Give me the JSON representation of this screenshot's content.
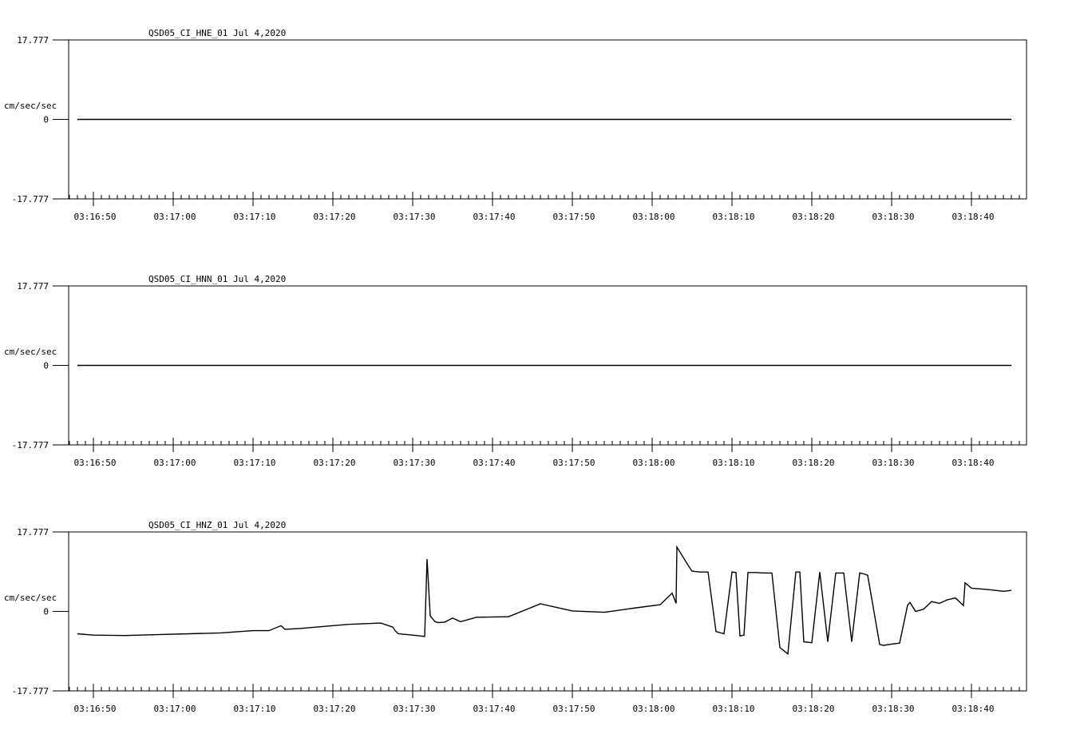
{
  "chart_data": [
    {
      "type": "line",
      "title": "QSD05_CI_HNE_01  Jul 4,2020",
      "ylabel": "cm/sec/sec",
      "ylim": [
        -17.777,
        17.777
      ],
      "y_tick_labels": [
        "17.777",
        "0",
        "-17.777"
      ],
      "x_tick_labels": [
        "03:16:50",
        "03:17:00",
        "03:17:10",
        "03:17:20",
        "03:17:30",
        "03:17:40",
        "03:17:50",
        "03:18:00",
        "03:18:10",
        "03:18:20",
        "03:18:30",
        "03:18:40"
      ],
      "xlim_seconds": [
        -3,
        117
      ],
      "grid": false,
      "series": [
        {
          "x": [
            0,
            117
          ],
          "y": [
            0,
            0
          ]
        }
      ]
    },
    {
      "type": "line",
      "title": "QSD05_CI_HNN_01  Jul 4,2020",
      "ylabel": "cm/sec/sec",
      "ylim": [
        -17.777,
        17.777
      ],
      "y_tick_labels": [
        "17.777",
        "0",
        "-17.777"
      ],
      "x_tick_labels": [
        "03:16:50",
        "03:17:00",
        "03:17:10",
        "03:17:20",
        "03:17:30",
        "03:17:40",
        "03:17:50",
        "03:18:00",
        "03:18:10",
        "03:18:20",
        "03:18:30",
        "03:18:40"
      ],
      "xlim_seconds": [
        -3,
        117
      ],
      "grid": false,
      "series": [
        {
          "x": [
            0,
            117
          ],
          "y": [
            0,
            0
          ]
        }
      ]
    },
    {
      "type": "line",
      "title": "QSD05_CI_HNZ_01  Jul 4,2020",
      "ylabel": "cm/sec/sec",
      "ylim": [
        -17.777,
        17.777
      ],
      "y_tick_labels": [
        "17.777",
        "0",
        "-17.777"
      ],
      "x_tick_labels": [
        "03:16:50",
        "03:17:00",
        "03:17:10",
        "03:17:20",
        "03:17:30",
        "03:17:40",
        "03:17:50",
        "03:18:00",
        "03:18:10",
        "03:18:20",
        "03:18:30",
        "03:18:40"
      ],
      "xlim_seconds": [
        -3,
        117
      ],
      "grid": false,
      "series": [
        {
          "x": [
            0,
            2,
            6,
            10,
            14,
            18,
            22,
            24,
            25.5,
            26,
            28,
            30,
            34,
            38,
            39.5,
            39.8,
            40.2,
            42,
            43.5,
            43.8,
            44.2,
            44.8,
            45.2,
            46,
            47,
            48,
            50,
            54,
            58,
            62,
            66,
            70,
            73,
            74.5,
            75,
            75.1,
            76.5,
            77,
            78,
            79,
            80,
            81,
            82,
            82.5,
            83,
            83.5,
            84,
            85,
            86,
            87,
            88,
            89,
            90,
            90.5,
            91,
            92,
            93,
            94,
            95,
            96,
            97,
            98,
            98.5,
            99,
            100.5,
            101,
            102,
            103,
            104,
            104.3,
            105,
            106,
            107,
            108,
            109,
            110,
            111,
            111.2,
            112,
            114,
            116,
            117
          ],
          "y": [
            -5.0,
            -5.3,
            -5.4,
            -5.2,
            -5.0,
            -4.8,
            -4.3,
            -4.3,
            -3.2,
            -4.0,
            -3.8,
            -3.5,
            -2.9,
            -2.6,
            -3.5,
            -4.3,
            -5.0,
            -5.3,
            -5.6,
            11.7,
            -1.0,
            -2.3,
            -2.5,
            -2.4,
            -1.5,
            -2.3,
            -1.3,
            -1.2,
            1.7,
            0.1,
            -0.2,
            0.8,
            1.5,
            4.1,
            1.8,
            14.4,
            10.3,
            9.0,
            8.8,
            8.8,
            -4.5,
            -5.0,
            8.8,
            8.7,
            -5.5,
            -5.3,
            8.7,
            8.7,
            8.6,
            8.6,
            -8.1,
            -9.5,
            8.8,
            8.8,
            -6.8,
            -7.0,
            8.8,
            -6.8,
            8.6,
            8.6,
            -6.8,
            8.6,
            8.4,
            8.1,
            -7.4,
            -7.6,
            -7.3,
            -7.1,
            1.4,
            2.0,
            0.0,
            0.5,
            2.2,
            1.8,
            2.6,
            3.0,
            1.3,
            6.4,
            5.2,
            4.9,
            4.5,
            4.7
          ]
        }
      ]
    }
  ]
}
